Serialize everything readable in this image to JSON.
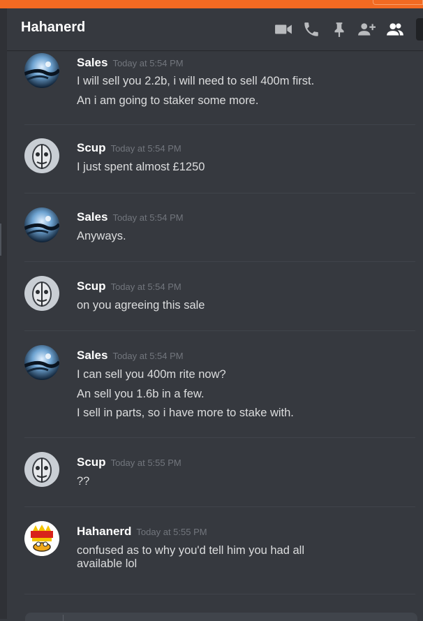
{
  "window": {
    "accent_color": "#f26a22"
  },
  "header": {
    "title": "Hahanerd",
    "icons": [
      "video-call-icon",
      "voice-call-icon",
      "pin-icon",
      "add-user-icon",
      "members-icon"
    ]
  },
  "messages": [
    {
      "author": "Sales",
      "timestamp": "Today at 5:54 PM",
      "avatar": "sales-avatar",
      "lines": [
        "I will sell you 2.2b, i will need to sell 400m first.",
        "An i am going to staker some more."
      ]
    },
    {
      "author": "Scup",
      "timestamp": "Today at 5:54 PM",
      "avatar": "scup-avatar",
      "lines": [
        "I just spent almost £1250"
      ]
    },
    {
      "author": "Sales",
      "timestamp": "Today at 5:54 PM",
      "avatar": "sales-avatar",
      "lines": [
        "Anyways."
      ]
    },
    {
      "author": "Scup",
      "timestamp": "Today at 5:54 PM",
      "avatar": "scup-avatar",
      "lines": [
        "on you agreeing this sale"
      ]
    },
    {
      "author": "Sales",
      "timestamp": "Today at 5:54 PM",
      "avatar": "sales-avatar",
      "lines": [
        "I can sell you 400m rite now?",
        "An sell you 1.6b in a few.",
        "I sell in parts, so i have more to stake with."
      ]
    },
    {
      "author": "Scup",
      "timestamp": "Today at 5:55 PM",
      "avatar": "scup-avatar",
      "lines": [
        "??"
      ]
    },
    {
      "author": "Hahanerd",
      "timestamp": "Today at 5:55 PM",
      "avatar": "hahanerd-avatar",
      "lines": [
        "confused as to why you'd tell him you had all",
        "available lol"
      ]
    }
  ]
}
